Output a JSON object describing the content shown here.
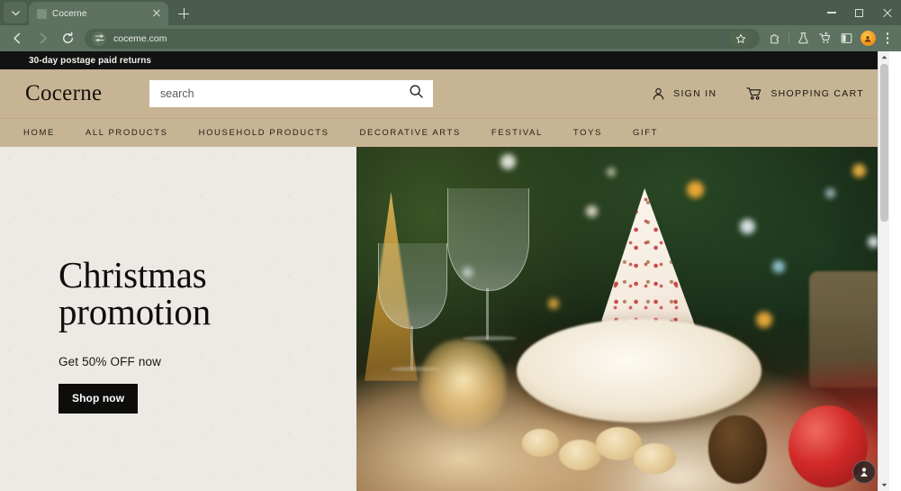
{
  "browser": {
    "tab": {
      "title": "Cocerne",
      "favicon_icon": "page-icon",
      "close_icon": "close-icon"
    },
    "tab_search_icon": "chevron-down-icon",
    "new_tab_icon": "plus-icon",
    "window_controls": {
      "minimize": "minimize-icon",
      "maximize": "maximize-icon",
      "close": "close-icon"
    },
    "nav": {
      "back_icon": "arrow-left-icon",
      "forward_icon": "arrow-right-icon",
      "reload_icon": "reload-icon"
    },
    "omnibox": {
      "url": "coceme.com",
      "site_settings_icon": "tune-icon"
    },
    "toolbar_icons": [
      {
        "name": "bookmark-star-icon"
      },
      {
        "name": "extensions-puzzle-icon"
      },
      {
        "name": "labs-flask-icon"
      },
      {
        "name": "shopping-list-icon"
      },
      {
        "name": "split-screen-icon"
      },
      {
        "name": "profile-avatar-icon"
      },
      {
        "name": "more-menu-icon"
      }
    ]
  },
  "page": {
    "promo_bar": {
      "text": "30-day postage paid returns"
    },
    "header": {
      "logo": "Cocerne",
      "search": {
        "placeholder": "search",
        "value": "",
        "icon": "search-icon"
      },
      "sign_in": {
        "label": "SIGN IN",
        "icon": "user-icon"
      },
      "cart": {
        "label": "SHOPPING CART",
        "icon": "cart-icon"
      }
    },
    "nav_items": [
      {
        "label": "HOME"
      },
      {
        "label": "ALL PRODUCTS"
      },
      {
        "label": "HOUSEHOLD PRODUCTS"
      },
      {
        "label": "DECORATIVE ARTS"
      },
      {
        "label": "FESTIVAL"
      },
      {
        "label": "TOYS"
      },
      {
        "label": "GIFT"
      }
    ],
    "hero": {
      "title_line1": "Christmas",
      "title_line2": "promotion",
      "subtitle": "Get 50% OFF now",
      "cta_label": "Shop now",
      "image_alt": "Christmas table setting with wine glasses, napkin, cookies and red ornament"
    },
    "float_widget": {
      "icon": "account-badge-icon"
    },
    "scrollbar": {
      "up_icon": "caret-up-icon",
      "down_icon": "caret-down-icon"
    }
  },
  "colors": {
    "browser_chrome": "#4a5c4d",
    "browser_toolbar": "#5d7260",
    "promo_bar_bg": "#121212",
    "header_bg": "#c7b494",
    "hero_panel_bg": "#eceae5",
    "cta_bg": "#0e0d0b",
    "accent_avatar": "#f0971f"
  }
}
